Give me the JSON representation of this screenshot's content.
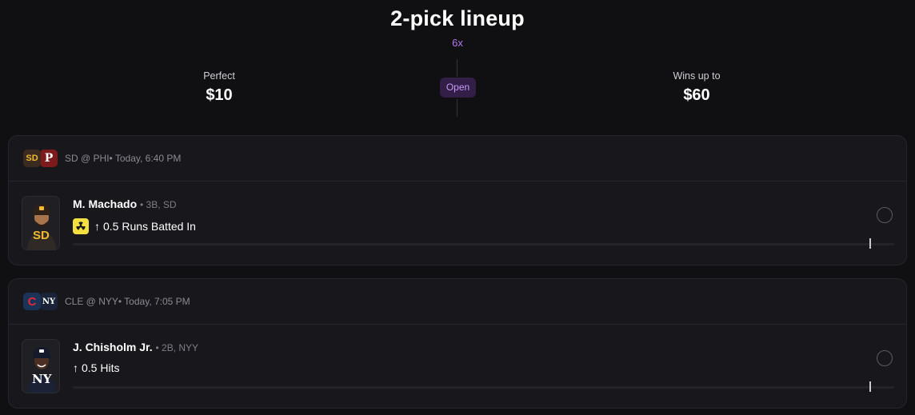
{
  "header": {
    "title": "2-pick lineup",
    "multiplier": "6x",
    "status": "Open",
    "perfect_label": "Perfect",
    "perfect_value": "$10",
    "wins_label": "Wins up to",
    "wins_value": "$60"
  },
  "picks": [
    {
      "teams": [
        {
          "abbr": "SD",
          "glyph": "SD",
          "bg": "#3b2a1f",
          "fg": "#f1b830"
        },
        {
          "abbr": "PHI",
          "glyph": "P",
          "bg": "#7c1a1c",
          "fg": "#ffffff"
        }
      ],
      "game": "SD @ PHI• Today, 6:40 PM",
      "player_name": "M. Machado",
      "player_meta": "• 3B, SD",
      "cap_logo": "SD",
      "line": "0.5 Runs Batted In",
      "direction": "↑",
      "boost_icon": "radiation-boost-icon",
      "progress": 0.97
    },
    {
      "teams": [
        {
          "abbr": "CLE",
          "glyph": "C",
          "bg": "#1c3358",
          "fg": "#e2283a"
        },
        {
          "abbr": "NYY",
          "glyph": "NY",
          "bg": "#1a2338",
          "fg": "#ffffff"
        }
      ],
      "game": "CLE @ NYY• Today, 7:05 PM",
      "player_name": "J. Chisholm Jr.",
      "player_meta": "• 2B, NYY",
      "cap_logo": "NY",
      "line": "0.5 Hits",
      "direction": "↑",
      "progress": 0.97
    }
  ],
  "colors": {
    "background": "#101013",
    "card": "#18181c",
    "accent_purple": "#b478f0",
    "boost_yellow": "#f3e040"
  }
}
